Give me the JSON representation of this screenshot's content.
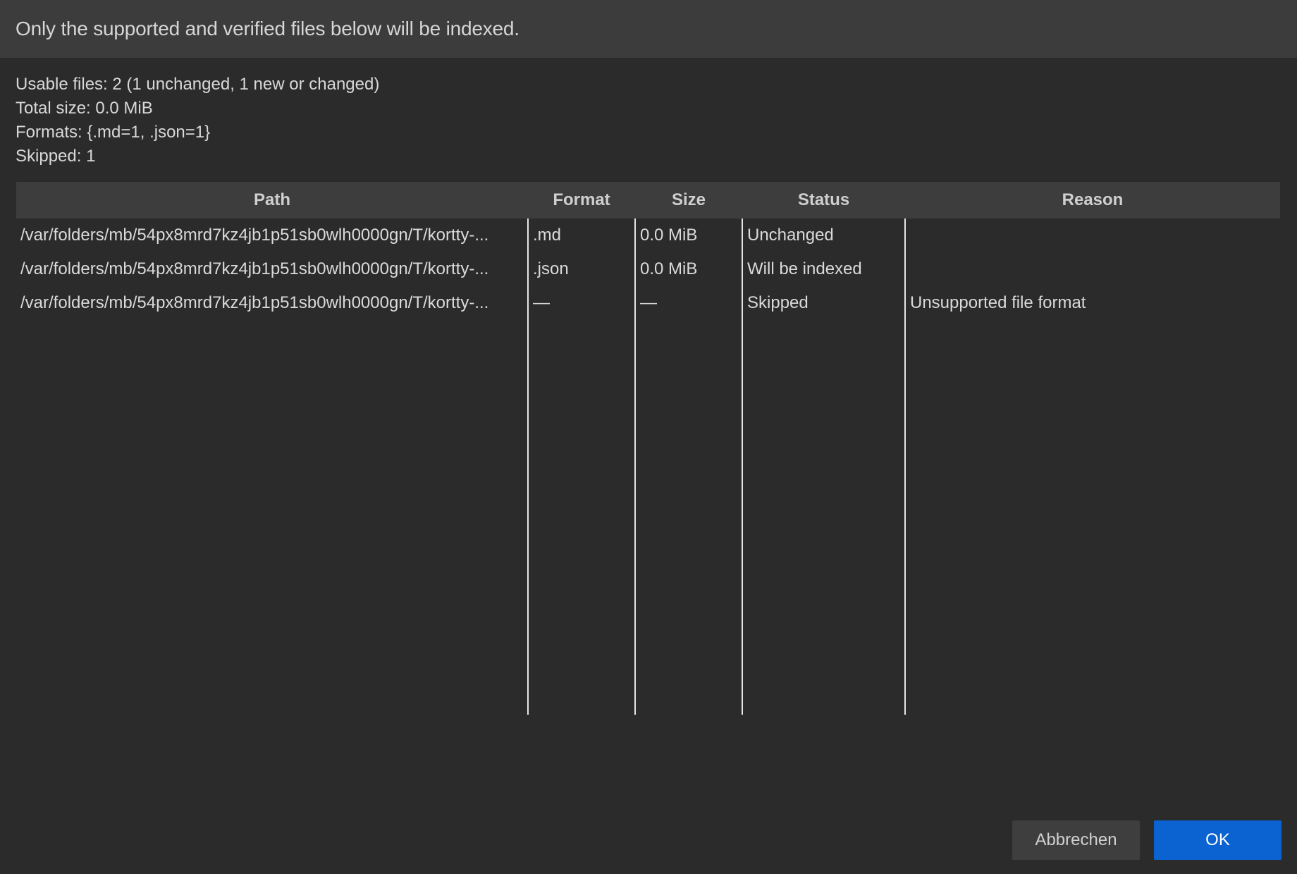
{
  "banner": {
    "text": "Only the supported and verified files below will be indexed."
  },
  "summary": {
    "usable_files": "Usable files: 2 (1 unchanged, 1 new or changed)",
    "total_size": "Total size: 0.0 MiB",
    "formats": "Formats: {.md=1, .json=1}",
    "skipped": "Skipped: 1"
  },
  "table": {
    "headers": {
      "path": "Path",
      "format": "Format",
      "size": "Size",
      "status": "Status",
      "reason": "Reason"
    },
    "rows": [
      {
        "path": "/var/folders/mb/54px8mrd7kz4jb1p51sb0wlh0000gn/T/kortty-...",
        "format": ".md",
        "size": "0.0 MiB",
        "status": "Unchanged",
        "reason": ""
      },
      {
        "path": "/var/folders/mb/54px8mrd7kz4jb1p51sb0wlh0000gn/T/kortty-...",
        "format": ".json",
        "size": "0.0 MiB",
        "status": "Will be indexed",
        "reason": ""
      },
      {
        "path": "/var/folders/mb/54px8mrd7kz4jb1p51sb0wlh0000gn/T/kortty-...",
        "format": "—",
        "size": "—",
        "status": "Skipped",
        "reason": "Unsupported file format"
      }
    ]
  },
  "buttons": {
    "cancel": "Abbrechen",
    "ok": "OK"
  },
  "colors": {
    "background": "#2b2b2b",
    "banner": "#3c3c3c",
    "header": "#3d3d3d",
    "accent": "#0a63d0"
  }
}
